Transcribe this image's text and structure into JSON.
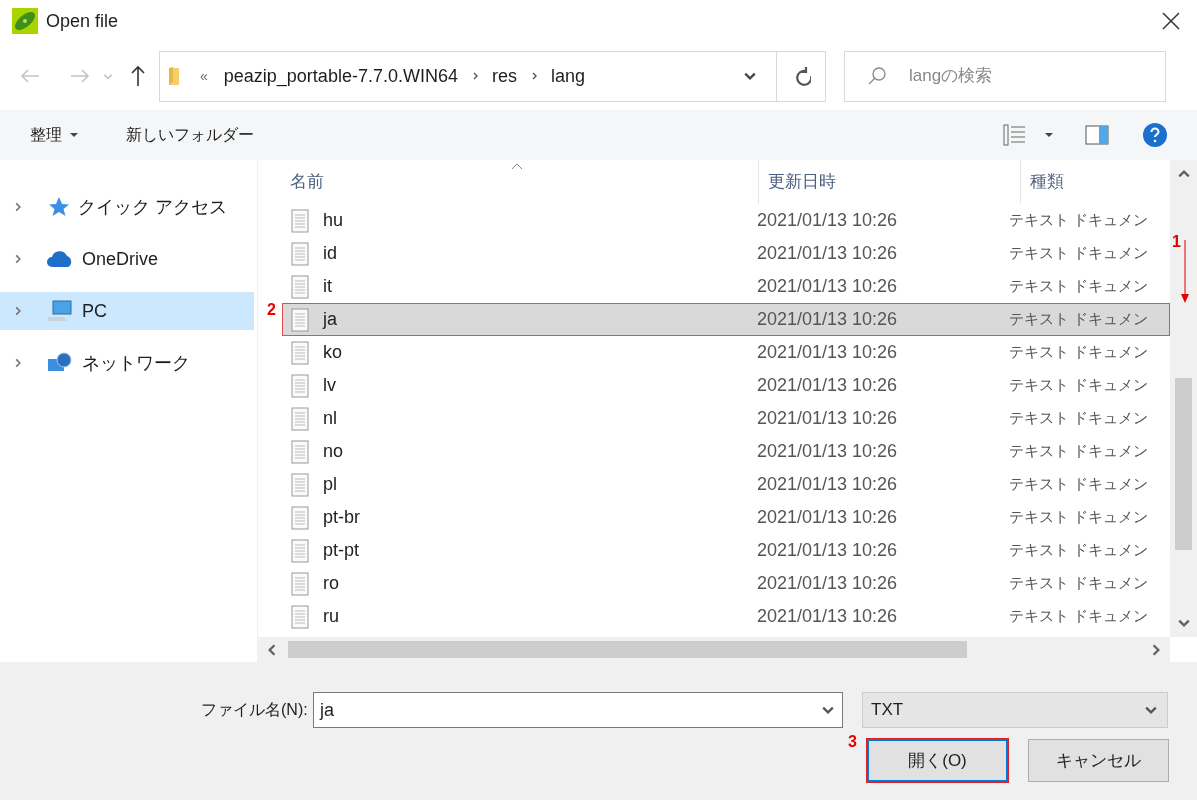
{
  "window": {
    "title": "Open file"
  },
  "address": {
    "overflow": "«",
    "crumbs": [
      "peazip_portable-7.7.0.WIN64",
      "res",
      "lang"
    ]
  },
  "search": {
    "placeholder": "langの検索"
  },
  "toolbar": {
    "organize": "整理",
    "new_folder": "新しいフォルダー"
  },
  "sidebar": {
    "items": [
      {
        "kind": "star",
        "label": "クイック アクセス",
        "selected": false
      },
      {
        "kind": "cloud",
        "label": "OneDrive",
        "selected": false
      },
      {
        "kind": "pc",
        "label": "PC",
        "selected": true
      },
      {
        "kind": "network",
        "label": "ネットワーク",
        "selected": false
      }
    ]
  },
  "table": {
    "columns": [
      "名前",
      "更新日時",
      "種類"
    ],
    "rows": [
      {
        "name": "hu",
        "date": "2021/01/13 10:26",
        "type": "テキスト ドキュメン",
        "selected": false
      },
      {
        "name": "id",
        "date": "2021/01/13 10:26",
        "type": "テキスト ドキュメン",
        "selected": false
      },
      {
        "name": "it",
        "date": "2021/01/13 10:26",
        "type": "テキスト ドキュメン",
        "selected": false
      },
      {
        "name": "ja",
        "date": "2021/01/13 10:26",
        "type": "テキスト ドキュメン",
        "selected": true
      },
      {
        "name": "ko",
        "date": "2021/01/13 10:26",
        "type": "テキスト ドキュメン",
        "selected": false
      },
      {
        "name": "lv",
        "date": "2021/01/13 10:26",
        "type": "テキスト ドキュメン",
        "selected": false
      },
      {
        "name": "nl",
        "date": "2021/01/13 10:26",
        "type": "テキスト ドキュメン",
        "selected": false
      },
      {
        "name": "no",
        "date": "2021/01/13 10:26",
        "type": "テキスト ドキュメン",
        "selected": false
      },
      {
        "name": "pl",
        "date": "2021/01/13 10:26",
        "type": "テキスト ドキュメン",
        "selected": false
      },
      {
        "name": "pt-br",
        "date": "2021/01/13 10:26",
        "type": "テキスト ドキュメン",
        "selected": false
      },
      {
        "name": "pt-pt",
        "date": "2021/01/13 10:26",
        "type": "テキスト ドキュメン",
        "selected": false
      },
      {
        "name": "ro",
        "date": "2021/01/13 10:26",
        "type": "テキスト ドキュメン",
        "selected": false
      },
      {
        "name": "ru",
        "date": "2021/01/13 10:26",
        "type": "テキスト ドキュメン",
        "selected": false
      }
    ]
  },
  "footer": {
    "filename_label": "ファイル名(N):",
    "filename": "ja",
    "filetype": "TXT",
    "open": "開く(O)",
    "cancel": "キャンセル"
  },
  "annotations": [
    {
      "label": "1"
    },
    {
      "label": "2"
    },
    {
      "label": "3"
    }
  ]
}
